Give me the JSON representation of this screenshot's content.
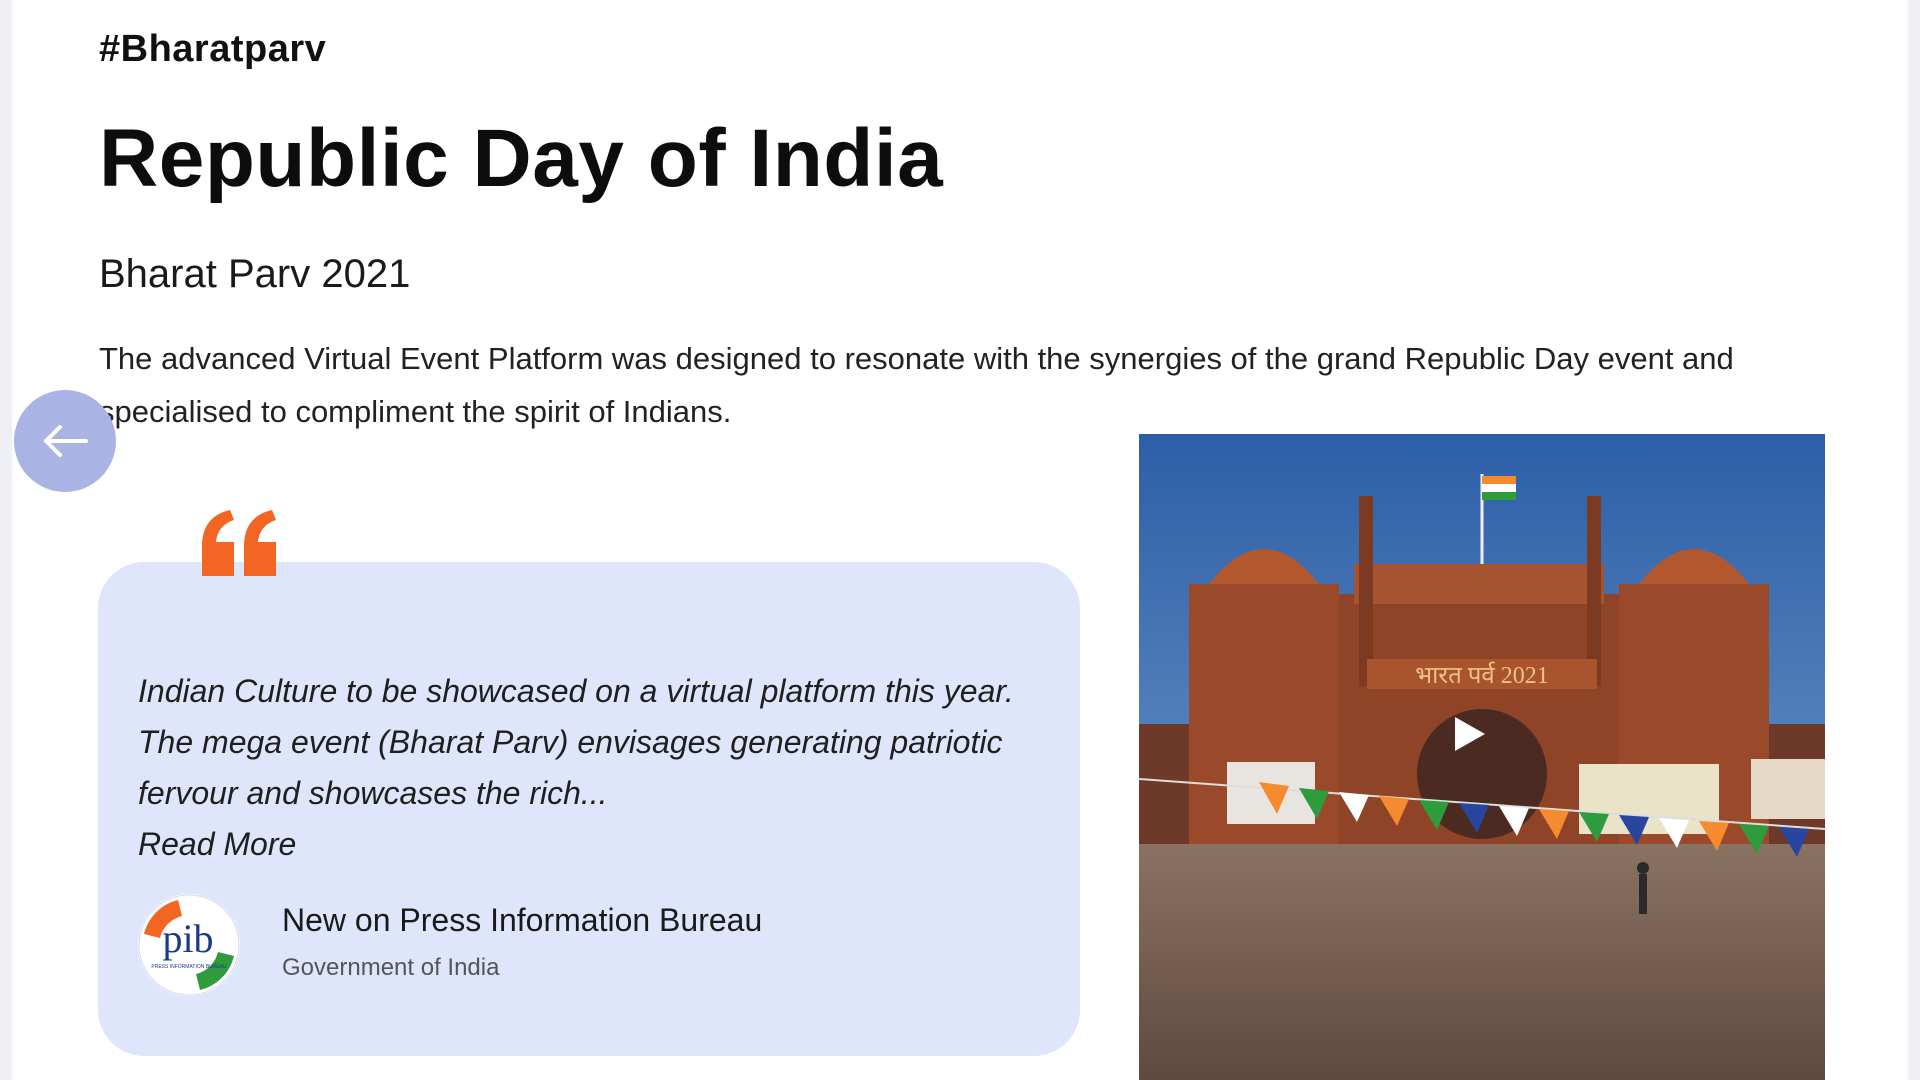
{
  "header": {
    "hashtag": "#Bharatparv",
    "title": "Republic Day of India",
    "subtitle": "Bharat Parv 2021",
    "description": "The advanced Virtual Event Platform was designed to resonate with the synergies of the grand Republic Day event and specialised to compliment the spirit of Indians."
  },
  "navigation": {
    "prev_icon": "arrow-left-icon"
  },
  "quote": {
    "icon": "quote-icon",
    "text": "Indian Culture to be showcased on a virtual platform this year. The mega event (Bharat Parv) envisages generating patriotic fervour and showcases the rich...",
    "read_more": "Read More",
    "source_name": "New on Press Information Bureau",
    "source_sub": "Government of India",
    "logo_text": "pib",
    "logo_sub_text": "PRESS INFORMATION BUREAU"
  },
  "video": {
    "banner_text": "भारत पर्व 2021",
    "play_icon": "play-icon"
  },
  "colors": {
    "accent_orange": "#f26522",
    "card_bg": "#dfe6fb",
    "nav_button": "#a9b4e4"
  }
}
